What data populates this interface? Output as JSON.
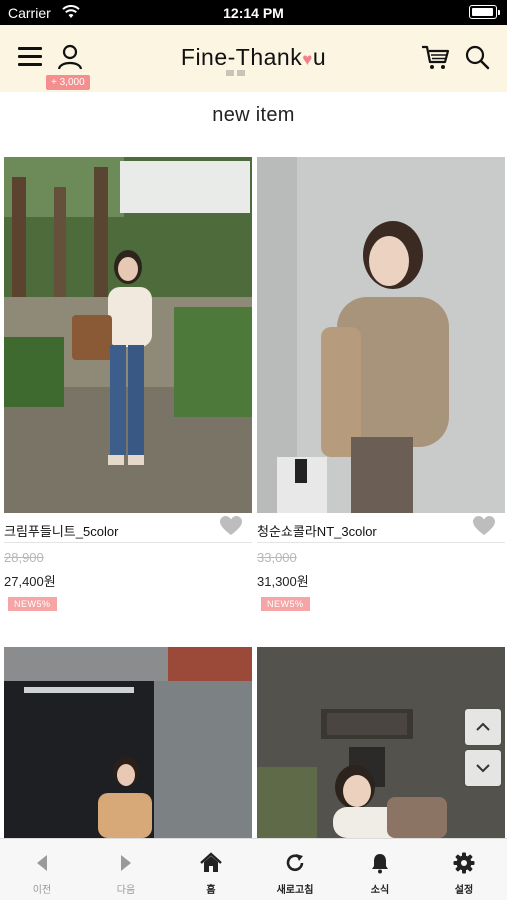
{
  "status_bar": {
    "carrier": "Carrier",
    "time": "12:14 PM",
    "battery_level": 0.9
  },
  "header": {
    "logo_prefix": "Fine-Thank",
    "logo_heart": "♥",
    "logo_suffix": "u",
    "points_badge": "+ 3,000",
    "icons": [
      "menu-icon",
      "user-icon",
      "cart-icon",
      "search-icon"
    ]
  },
  "section": {
    "title": "new item"
  },
  "products": [
    {
      "name": "크림푸들니트_5color",
      "old_price": "28,900",
      "price": "27,400원",
      "badge": "NEW5%"
    },
    {
      "name": "청순쇼콜라NT_3color",
      "old_price": "33,000",
      "price": "31,300원",
      "badge": "NEW5%"
    },
    {
      "name": "",
      "old_price": "",
      "price": "",
      "badge": ""
    },
    {
      "name": "",
      "old_price": "",
      "price": "",
      "badge": ""
    }
  ],
  "toolbar": {
    "items": [
      {
        "label": "이전",
        "icon": "back-arrow-icon"
      },
      {
        "label": "다음",
        "icon": "forward-arrow-icon"
      },
      {
        "label": "홈",
        "icon": "home-icon"
      },
      {
        "label": "새로고침",
        "icon": "refresh-icon"
      },
      {
        "label": "소식",
        "icon": "bell-icon"
      },
      {
        "label": "설정",
        "icon": "gear-icon"
      }
    ]
  },
  "colors": {
    "header_bg": "#fcf5e2",
    "points_badge": "#f58e8e",
    "new_badge": "#f5a5a5",
    "heart": "#f0808a"
  }
}
